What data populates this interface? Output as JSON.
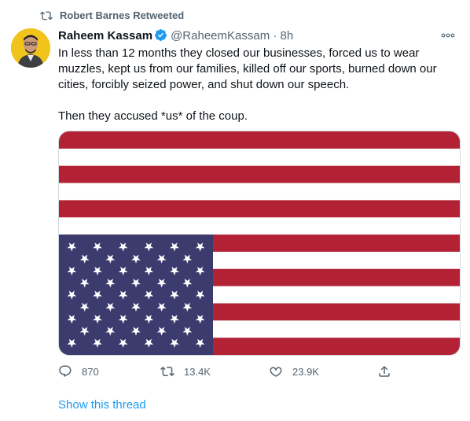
{
  "retweet": {
    "icon": "retweet-icon",
    "label": "Robert Barnes Retweeted"
  },
  "tweet": {
    "author_name": "Raheem Kassam",
    "verified_icon": "verified-badge-icon",
    "handle": "@RaheemKassam",
    "separator": "·",
    "time": "8h",
    "more_icon": "more-options-icon",
    "text_paragraph_1": "In less than 12 months they closed our businesses, forced us to wear muzzles, kept us from our families, killed off our sports, burned down our cities, forcibly seized power, and shut down our speech.",
    "text_paragraph_2": "Then they accused *us* of the coup.",
    "media": {
      "description_icon": "upside-down-us-flag-image",
      "colors": {
        "red": "#b22234",
        "white": "#ffffff",
        "blue": "#3c3b6e"
      }
    },
    "actions": {
      "reply_count": "870",
      "retweet_count": "13.4K",
      "like_count": "23.9K"
    },
    "show_thread_label": "Show this thread"
  },
  "colors": {
    "accent": "#1d9bf0",
    "secondary_text": "#536471",
    "avatar_bg": "#f1c41c"
  }
}
